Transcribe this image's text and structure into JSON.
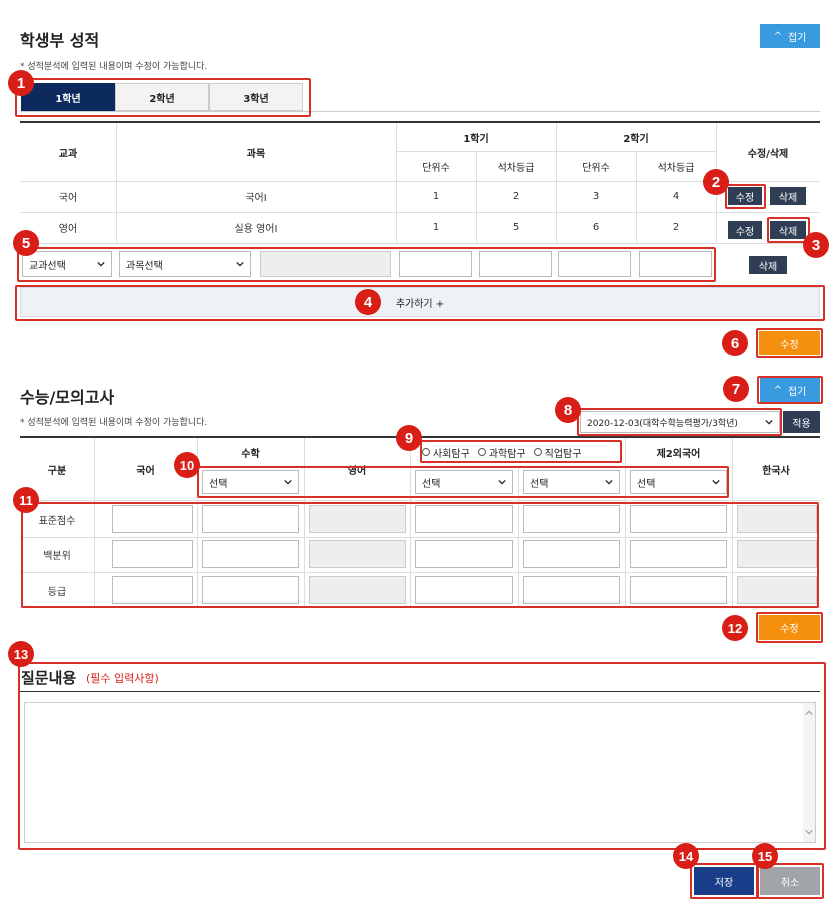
{
  "records": {
    "title": "학생부 성적",
    "collapse_label": "접기",
    "note": "* 성적분석에 입력된 내용이며 수정이 가능합니다.",
    "tabs": [
      "1학년",
      "2학년",
      "3학년"
    ],
    "headers": {
      "subject": "교과",
      "course": "과목",
      "sem1": "1학기",
      "sem2": "2학기",
      "units": "단위수",
      "grade": "석차등급",
      "edit_delete": "수정/삭제"
    },
    "rows": [
      {
        "subject": "국어",
        "course": "국어Ⅰ",
        "s1_units": "1",
        "s1_grade": "2",
        "s2_units": "3",
        "s2_grade": "4"
      },
      {
        "subject": "영어",
        "course": "실용 영어Ⅰ",
        "s1_units": "1",
        "s1_grade": "5",
        "s2_units": "6",
        "s2_grade": "2"
      }
    ],
    "edit_label": "수정",
    "delete_label": "삭제",
    "subject_select": "교과선택",
    "course_select": "과목선택",
    "add_label": "추가하기 +",
    "save_label": "수정"
  },
  "mock": {
    "title": "수능/모의고사",
    "collapse_label": "접기",
    "note": "* 성적분석에 입력된 내용이며 수정이 가능합니다.",
    "exam_select": "2020-12-03(대학수학능력평가/3학년)",
    "apply_label": "적용",
    "headers": {
      "category": "구분",
      "korean": "국어",
      "math": "수학",
      "english": "영어",
      "second_lang": "제2외국어",
      "history": "한국사"
    },
    "radio_options": [
      "사회탐구",
      "과학탐구",
      "직업탐구"
    ],
    "select_placeholder": "선택",
    "row_labels": [
      "표준점수",
      "백분위",
      "등급"
    ],
    "save_label": "수정"
  },
  "question": {
    "title": "질문내용",
    "required": "(필수 입력사항)"
  },
  "footer": {
    "save_label": "저장",
    "cancel_label": "취소"
  },
  "badges": [
    "1",
    "2",
    "3",
    "4",
    "5",
    "6",
    "7",
    "8",
    "9",
    "10",
    "11",
    "12",
    "13",
    "14",
    "15"
  ],
  "colors": {
    "annotation_red": "#d81e17",
    "accent_blue": "#3a9ae0",
    "accent_orange": "#f5900f",
    "navy": "#0d2a5e",
    "dark_button": "#2f3d55"
  }
}
